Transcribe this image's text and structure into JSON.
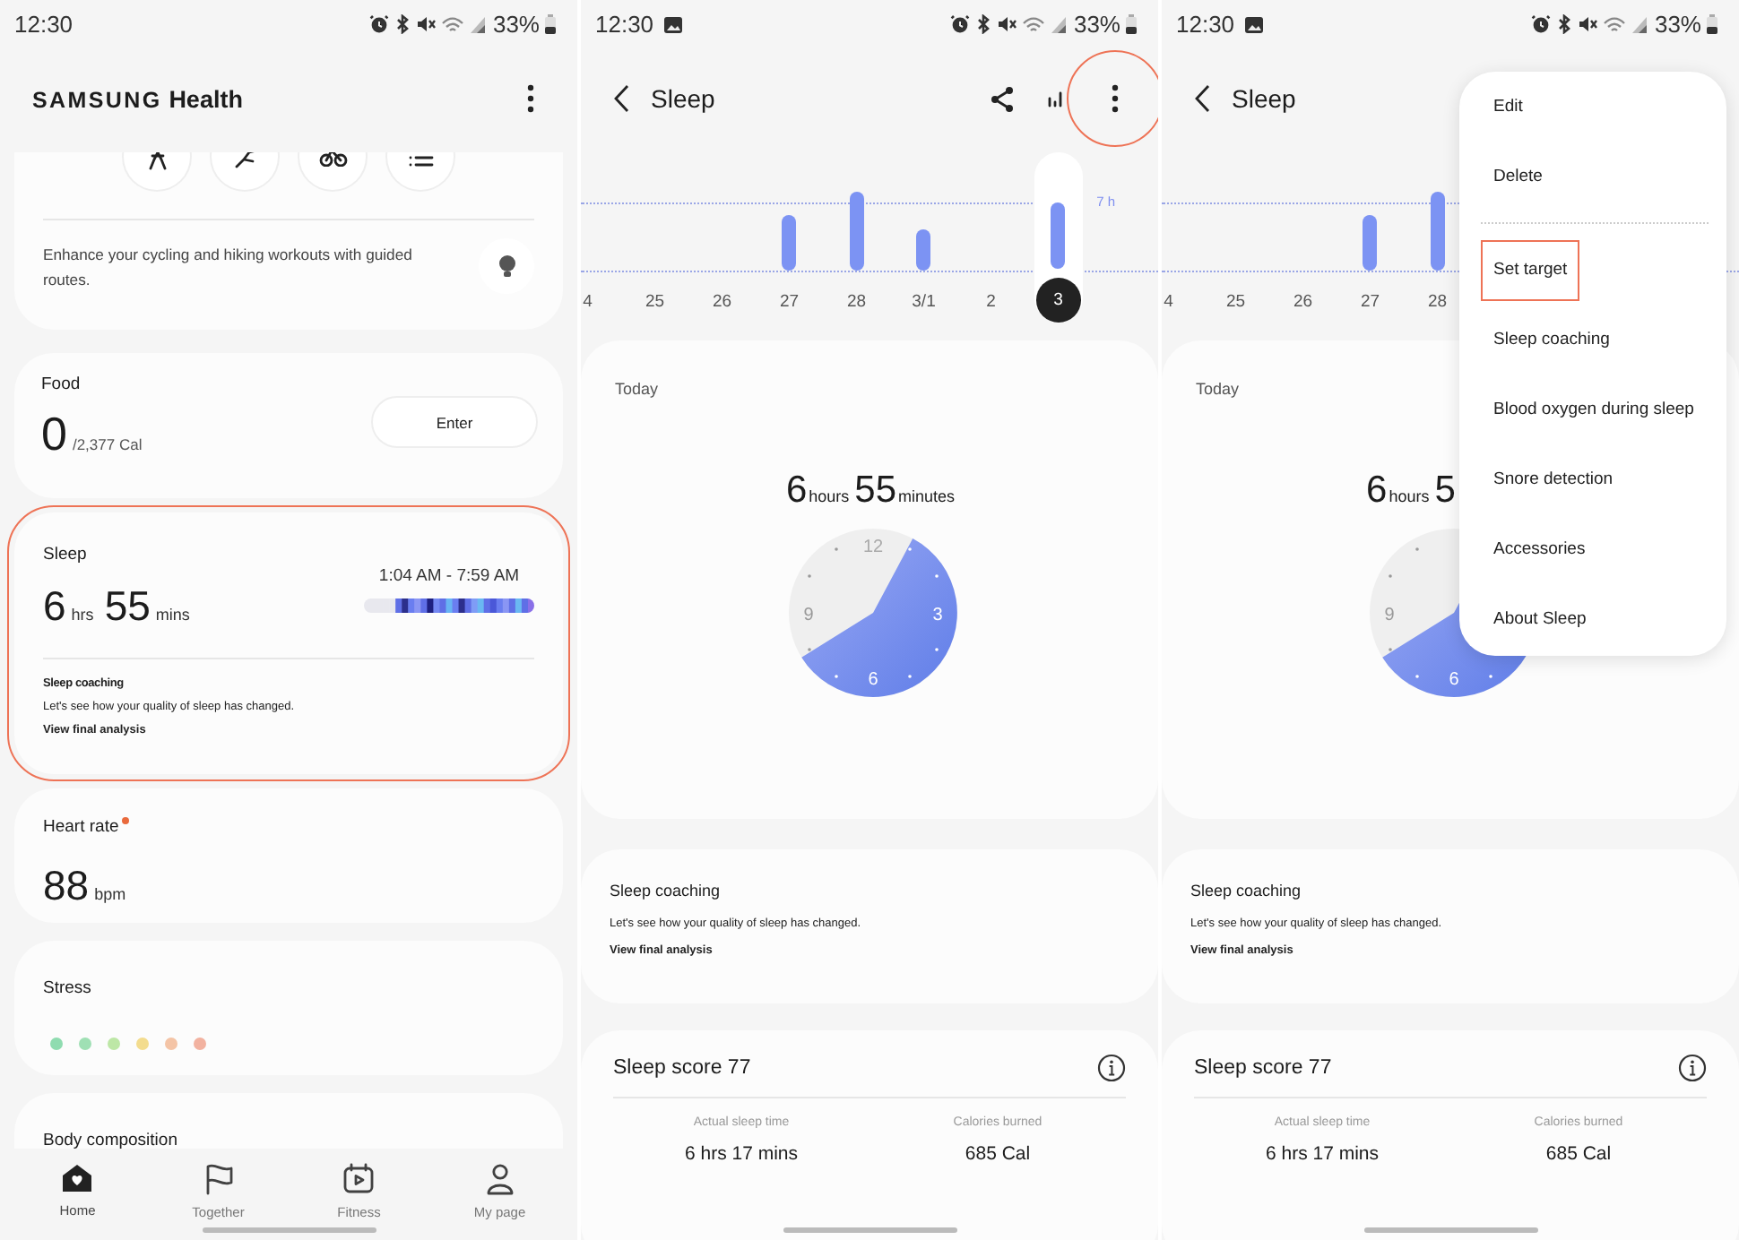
{
  "panels": [
    {
      "kind": "home",
      "status_bar": {
        "time": "12:30",
        "battery": "33%",
        "screenshot_notice": false
      },
      "header": {
        "logo_brand": "SAMSUNG",
        "logo_app": "Health"
      },
      "shortcuts": [
        {
          "kind": "walk"
        },
        {
          "kind": "run"
        },
        {
          "kind": "bike"
        },
        {
          "kind": "list"
        }
      ],
      "tip": "Enhance your cycling and hiking workouts with guided routes.",
      "food": {
        "title": "Food",
        "value": "0",
        "target": "/2,377 Cal",
        "button": "Enter"
      },
      "sleep": {
        "title": "Sleep",
        "hours": "6",
        "hours_unit": "hrs",
        "minutes": "55",
        "minutes_unit": "mins",
        "range": "1:04 AM - 7:59 AM",
        "coaching_title": "Sleep coaching",
        "coaching_text": "Let's see how your quality of sleep has changed.",
        "coaching_link": "View final analysis",
        "annotated": true
      },
      "heart_rate": {
        "title": "Heart rate",
        "alert": true,
        "value": "88",
        "unit": "bpm"
      },
      "stress": {
        "title": "Stress",
        "levels": [
          {
            "color": "#8fdcb0"
          },
          {
            "color": "#9fe0b4"
          },
          {
            "color": "#bde7a6"
          },
          {
            "color": "#f3dc8e"
          },
          {
            "color": "#f4c4a6"
          },
          {
            "color": "#f2b2a0"
          }
        ]
      },
      "body_composition": {
        "title": "Body composition"
      },
      "nav": [
        {
          "kind": "home",
          "label": "Home",
          "selected": true
        },
        {
          "kind": "together",
          "label": "Together",
          "selected": false
        },
        {
          "kind": "fitness",
          "label": "Fitness",
          "selected": false
        },
        {
          "kind": "mypage",
          "label": "My page",
          "selected": false
        }
      ]
    },
    {
      "kind": "sleep",
      "status_bar": {
        "time": "12:30",
        "battery": "33%",
        "screenshot_notice": true
      },
      "header": {
        "title": "Sleep",
        "actions": [
          {
            "kind": "share"
          },
          {
            "kind": "chart"
          },
          {
            "kind": "more",
            "annotated": true
          }
        ]
      },
      "chart": {
        "target_label": "7 h",
        "days": [
          {
            "label": "4",
            "selected": false
          },
          {
            "label": "25",
            "selected": false
          },
          {
            "label": "26",
            "selected": false
          },
          {
            "label": "27",
            "selected": false
          },
          {
            "label": "28",
            "selected": false
          },
          {
            "label": "3/1",
            "selected": false
          },
          {
            "label": "2",
            "selected": false
          },
          {
            "label": "3",
            "selected": true
          }
        ]
      },
      "summary": {
        "title": "Today",
        "hours": "6",
        "hours_unit": "hours",
        "minutes": "55",
        "minutes_unit": "minutes",
        "clock_labels": [
          {
            "kind": "top",
            "text": "12"
          },
          {
            "kind": "right",
            "text": "3"
          },
          {
            "kind": "bottom",
            "text": "6"
          },
          {
            "kind": "left",
            "text": "9"
          }
        ]
      },
      "coaching": {
        "title": "Sleep coaching",
        "text": "Let's see how your quality of sleep has changed.",
        "link": "View final analysis"
      },
      "score": {
        "title": "Sleep score 77",
        "stats": [
          {
            "label": "Actual sleep time",
            "value": "6 hrs 17 mins"
          },
          {
            "label": "Calories burned",
            "value": "685 Cal"
          }
        ]
      }
    },
    {
      "kind": "sleep",
      "status_bar": {
        "time": "12:30",
        "battery": "33%",
        "screenshot_notice": true
      },
      "header": {
        "title": "Sleep"
      },
      "chart": {
        "days": [
          {
            "label": "4",
            "selected": false
          },
          {
            "label": "25",
            "selected": false
          },
          {
            "label": "26",
            "selected": false
          },
          {
            "label": "27",
            "selected": false
          },
          {
            "label": "28",
            "selected": false
          }
        ]
      },
      "summary": {
        "title": "Today",
        "hours": "6",
        "hours_unit": "hours",
        "minutes": "5",
        "clock_labels": [
          {
            "kind": "bottom",
            "text": "6"
          },
          {
            "kind": "left",
            "text": "9"
          }
        ]
      },
      "coaching": {
        "title": "Sleep coaching",
        "text": "Let's see how your quality of sleep has changed.",
        "link": "View final analysis"
      },
      "score": {
        "title": "Sleep score 77",
        "stats": [
          {
            "label": "Actual sleep time",
            "value": "6 hrs 17 mins"
          },
          {
            "label": "Calories burned",
            "value": "685 Cal"
          }
        ]
      },
      "menu": {
        "groups": [
          [
            {
              "label": "Edit",
              "annotated": false
            },
            {
              "label": "Delete",
              "annotated": false
            }
          ],
          [
            {
              "label": "Set target",
              "annotated": true
            },
            {
              "label": "Sleep coaching",
              "annotated": false
            },
            {
              "label": "Blood oxygen during sleep",
              "annotated": false
            },
            {
              "label": "Snore detection",
              "annotated": false
            },
            {
              "label": "Accessories",
              "annotated": false
            },
            {
              "label": "About Sleep",
              "annotated": false
            }
          ]
        ]
      }
    }
  ]
}
